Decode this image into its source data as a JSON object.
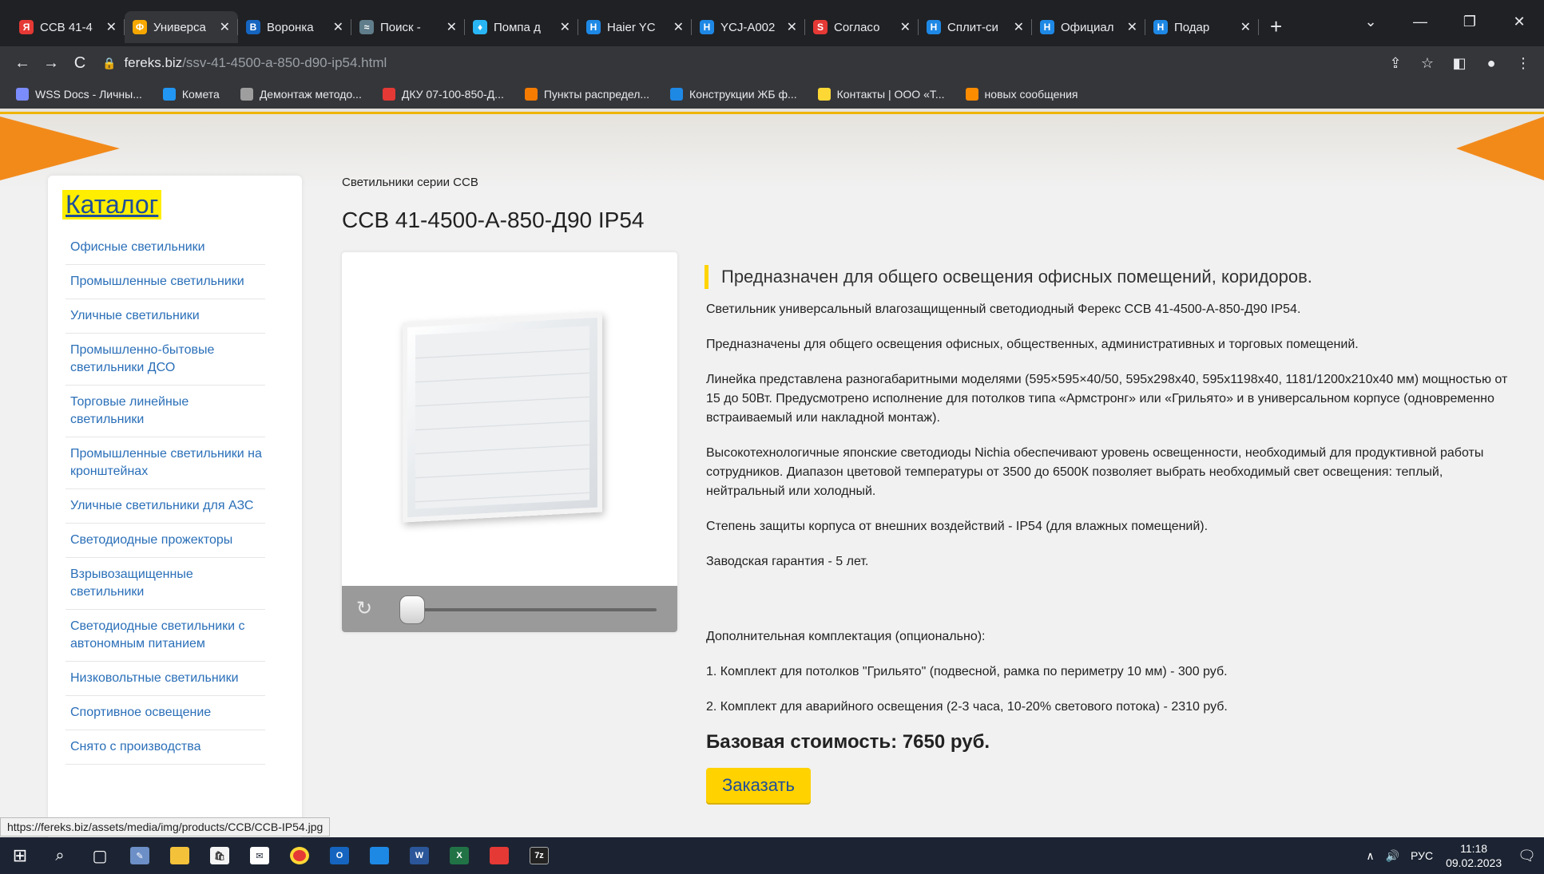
{
  "browser": {
    "tabs": [
      {
        "title": "ССВ 41-4",
        "icon_color": "#e53935",
        "icon_letter": "Я",
        "active": false
      },
      {
        "title": "Универса",
        "icon_color": "#f6a800",
        "icon_letter": "Ф",
        "active": true
      },
      {
        "title": "Воронка",
        "icon_color": "#1565c0",
        "icon_letter": "В",
        "active": false
      },
      {
        "title": "Поиск -",
        "icon_color": "#607d8b",
        "icon_letter": "≈",
        "active": false
      },
      {
        "title": "Помпа д",
        "icon_color": "#29b6f6",
        "icon_letter": "♦",
        "active": false
      },
      {
        "title": "Haier YC",
        "icon_color": "#1e88e5",
        "icon_letter": "H",
        "active": false
      },
      {
        "title": "YCJ-A002",
        "icon_color": "#1e88e5",
        "icon_letter": "H",
        "active": false
      },
      {
        "title": "Согласо",
        "icon_color": "#e53935",
        "icon_letter": "S",
        "active": false
      },
      {
        "title": "Сплит-си",
        "icon_color": "#1e88e5",
        "icon_letter": "H",
        "active": false
      },
      {
        "title": "Официал",
        "icon_color": "#1e88e5",
        "icon_letter": "H",
        "active": false
      },
      {
        "title": "Подар",
        "icon_color": "#1e88e5",
        "icon_letter": "H",
        "active": false
      }
    ],
    "new_tab": "+",
    "url_domain": "fereks.biz",
    "url_path": "/ssv-41-4500-a-850-d90-ip54.html",
    "bookmarks": [
      {
        "label": "WSS Docs - Личны...",
        "color": "#7b8cff"
      },
      {
        "label": "Комета",
        "color": "#2196f3"
      },
      {
        "label": "Демонтаж методо...",
        "color": "#9e9e9e"
      },
      {
        "label": "ДКУ 07-100-850-Д...",
        "color": "#e53935"
      },
      {
        "label": "Пункты распредел...",
        "color": "#f57c00"
      },
      {
        "label": "Конструкции ЖБ ф...",
        "color": "#1e88e5"
      },
      {
        "label": "Контакты | ООО «Т...",
        "color": "#fdd835"
      },
      {
        "label": "новых сообщения",
        "color": "#fb8c00"
      }
    ],
    "status_url": "https://fereks.biz/assets/media/img/products/CCB/CCB-IP54.jpg"
  },
  "sidebar": {
    "title": "Каталог",
    "items": [
      "Офисные светильники",
      "Промышленные светильники",
      "Уличные светильники",
      "Промышленно-бытовые светильники ДСО",
      "Торговые линейные светильники",
      "Промышленные светильники на кронштейнах",
      "Уличные светильники для АЗС",
      "Светодиодные прожекторы",
      "Взрывозащищенные светильники",
      "Светодиодные светильники с автономным питанием",
      "Низковольтные светильники",
      "Спортивное освещение",
      "Снято с производства"
    ]
  },
  "product": {
    "breadcrumb": "Светильники серии ССВ",
    "title": "ССВ 41-4500-А-850-Д90 IP54",
    "lead": "Предназначен для общего освещения офисных помещений, коридоров.",
    "paragraphs": [
      "Светильник универсальный влагозащищенный светодиодный Ферекс ССВ 41-4500-А-850-Д90 IP54.",
      "Предназначены для общего освещения офисных, общественных, административных и торговых помещений.",
      "Линейка представлена разногабаритными моделями (595×595×40/50, 595х298х40, 595х1198х40, 1181/1200х210х40 мм) мощностью от 15 до 50Вт. Предусмотрено исполнение для потолков типа «Армстронг» или «Грильято» и в универсальном корпусе (одновременно встраиваемый или накладной монтаж).",
      "Высокотехнологичные японские светодиоды Nichia обеспечивают уровень освещенности, необходимый для продуктивной работы сотрудников. Диапазон цветовой температуры от 3500 до 6500К позволяет выбрать необходимый свет освещения: теплый, нейтральный или холодный.",
      "Степень защиты корпуса от внешних воздействий - IP54 (для влажных помещений).",
      "Заводская гарантия - 5 лет."
    ],
    "extras_title": "Дополнительная комплектация (опционально):",
    "extras": [
      "1. Комплект для потолков \"Грильято\" (подвесной, рамка по периметру 10 мм) - 300 руб.",
      "2. Комплект для аварийного освещения (2-3 часа, 10-20% светового потока) - 2310 руб."
    ],
    "price": "Базовая стоимость: 7650 руб.",
    "order_button": "Заказать"
  },
  "taskbar": {
    "lang": "РУС",
    "time": "11:18",
    "date": "09.02.2023"
  },
  "colors": {
    "accent_yellow": "#ffd200",
    "link_blue": "#2a6fb8",
    "orange": "#f28a1a"
  }
}
